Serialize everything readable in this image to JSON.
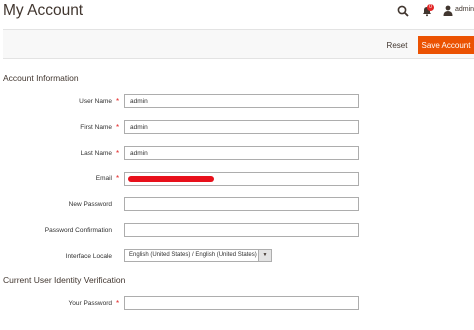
{
  "page": {
    "title": "My Account"
  },
  "header": {
    "search_icon": "search-icon",
    "notifications_icon": "bell-icon",
    "notifications_count": "0",
    "user_icon": "user-icon",
    "user_name": "admin"
  },
  "actions": {
    "reset_label": "Reset",
    "save_label": "Save Account"
  },
  "account_info": {
    "title": "Account Information",
    "user_name": {
      "label": "User Name",
      "value": "admin"
    },
    "first_name": {
      "label": "First Name",
      "value": "admin"
    },
    "last_name": {
      "label": "Last Name",
      "value": "admin"
    },
    "email": {
      "label": "Email",
      "value": ""
    },
    "new_password": {
      "label": "New Password",
      "value": ""
    },
    "password_confirmation": {
      "label": "Password Confirmation",
      "value": ""
    },
    "interface_locale": {
      "label": "Interface Locale",
      "selected": "English (United States) / English (United States)"
    }
  },
  "verification": {
    "title": "Current User Identity Verification",
    "your_password": {
      "label": "Your Password",
      "value": ""
    }
  },
  "colors": {
    "accent": "#eb5202",
    "required": "#e22626",
    "redaction": "#e8101b"
  }
}
